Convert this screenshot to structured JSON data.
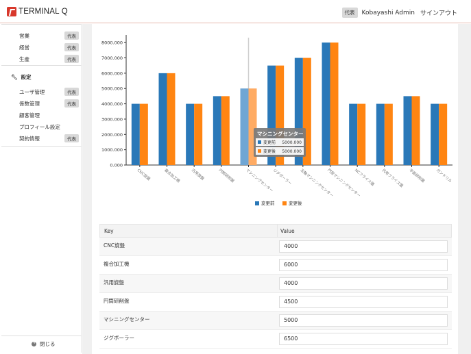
{
  "header": {
    "logo_text": "TERMINAL Q",
    "role_badge": "代表",
    "user_name": "Kobayashi Admin",
    "signout_label": "サインアウト"
  },
  "sidebar": {
    "group1": [
      {
        "label": "営業",
        "badge": "代表"
      },
      {
        "label": "経営",
        "badge": "代表"
      },
      {
        "label": "生産",
        "badge": "代表"
      }
    ],
    "settings_title": "設定",
    "group2": [
      {
        "label": "ユーザ管理",
        "badge": "代表"
      },
      {
        "label": "係数管理",
        "badge": "代表"
      },
      {
        "label": "顧客管理",
        "badge": ""
      },
      {
        "label": "プロフィール設定",
        "badge": ""
      },
      {
        "label": "契約情報",
        "badge": "代表"
      }
    ],
    "close_label": "閉じる"
  },
  "chart_data": {
    "type": "bar",
    "categories": [
      "CNC旋盤",
      "複合加工機",
      "汎用旋盤",
      "円筒研削盤",
      "マシニングセンター",
      "ジグボーラー",
      "五軸マシニングセンター",
      "門型マシニングセンター",
      "NCフライス盤",
      "汎用フライス盤",
      "平面研削盤",
      "ガンドリル"
    ],
    "series": [
      {
        "name": "変更前",
        "color": "#2a78b8",
        "values": [
          4000,
          6000,
          4000,
          4500,
          5000,
          6500,
          7000,
          8000,
          4000,
          4000,
          4500,
          4000
        ]
      },
      {
        "name": "変更後",
        "color": "#ff8512",
        "values": [
          4000,
          6000,
          4000,
          4500,
          5000,
          6500,
          7000,
          8000,
          4000,
          4000,
          4500,
          4000
        ]
      }
    ],
    "ylim": [
      0,
      8500
    ],
    "yticks": [
      "0.000",
      "1000.000",
      "2000.000",
      "3000.000",
      "4000.000",
      "5000.000",
      "6000.000",
      "7000.000",
      "8000.000"
    ],
    "legend": "bottom-center",
    "tooltip": {
      "title": "マシニングセンター",
      "rows": [
        {
          "name": "変更前",
          "value": "5000.000"
        },
        {
          "name": "変更後",
          "value": "5000.000"
        }
      ]
    }
  },
  "table": {
    "header_key": "Key",
    "header_value": "Value",
    "rows": [
      {
        "key": "CNC旋盤",
        "value": "4000"
      },
      {
        "key": "複合加工機",
        "value": "6000"
      },
      {
        "key": "汎用旋盤",
        "value": "4000"
      },
      {
        "key": "円筒研削盤",
        "value": "4500"
      },
      {
        "key": "マシニングセンター",
        "value": "5000"
      },
      {
        "key": "ジグボーラー",
        "value": "6500"
      }
    ]
  }
}
